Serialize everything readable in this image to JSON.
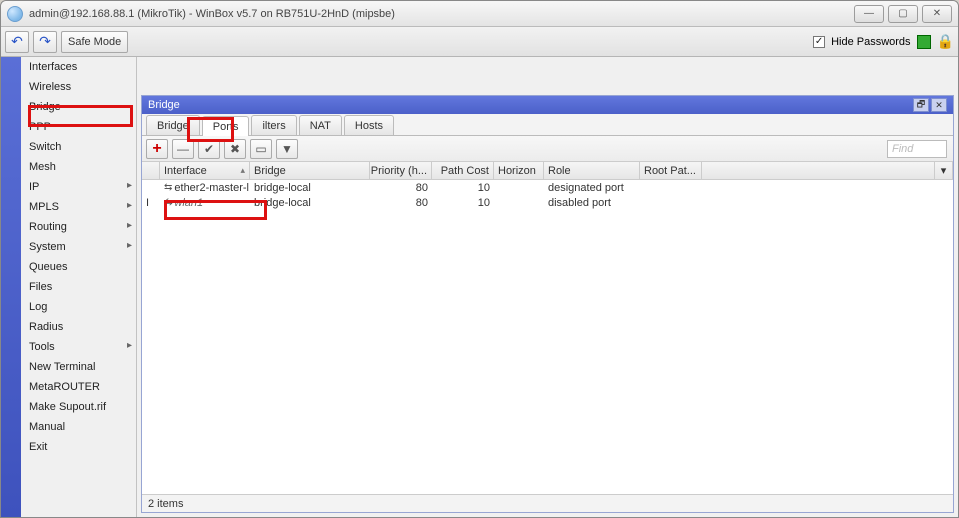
{
  "window": {
    "title": "admin@192.168.88.1 (MikroTik) - WinBox v5.7 on RB751U-2HnD (mipsbe)"
  },
  "toolbar": {
    "undo_symbol": "↶",
    "redo_symbol": "↷",
    "safe_mode": "Safe Mode",
    "hide_passwords": "Hide Passwords"
  },
  "menu": {
    "items": [
      {
        "label": "Interfaces",
        "sub": false
      },
      {
        "label": "Wireless",
        "sub": false
      },
      {
        "label": "Bridge",
        "sub": false
      },
      {
        "label": "PPP",
        "sub": false
      },
      {
        "label": "Switch",
        "sub": false
      },
      {
        "label": "Mesh",
        "sub": false
      },
      {
        "label": "IP",
        "sub": true
      },
      {
        "label": "MPLS",
        "sub": true
      },
      {
        "label": "Routing",
        "sub": true
      },
      {
        "label": "System",
        "sub": true
      },
      {
        "label": "Queues",
        "sub": false
      },
      {
        "label": "Files",
        "sub": false
      },
      {
        "label": "Log",
        "sub": false
      },
      {
        "label": "Radius",
        "sub": false
      },
      {
        "label": "Tools",
        "sub": true
      },
      {
        "label": "New Terminal",
        "sub": false
      },
      {
        "label": "MetaROUTER",
        "sub": false
      },
      {
        "label": "Make Supout.rif",
        "sub": false
      },
      {
        "label": "Manual",
        "sub": false
      },
      {
        "label": "Exit",
        "sub": false
      }
    ]
  },
  "bridge": {
    "title": "Bridge",
    "tabs": [
      "Bridge",
      "Ports",
      "ilters",
      "NAT",
      "Hosts"
    ],
    "find_placeholder": "Find",
    "columns": {
      "interface": "Interface",
      "bridge": "Bridge",
      "priority": "Priority (h...",
      "path_cost": "Path Cost",
      "horizon": "Horizon",
      "role": "Role",
      "root_path": "Root Pat..."
    },
    "rows": [
      {
        "flag": "",
        "interface": "ether2-master-l",
        "bridge": "bridge-local",
        "priority": "80",
        "path_cost": "10",
        "horizon": "",
        "role": "designated port",
        "root_path": ""
      },
      {
        "flag": "I",
        "interface": "wlan1",
        "bridge": "bridge-local",
        "priority": "80",
        "path_cost": "10",
        "horizon": "",
        "role": "disabled port",
        "root_path": ""
      }
    ],
    "status": "2 items"
  }
}
